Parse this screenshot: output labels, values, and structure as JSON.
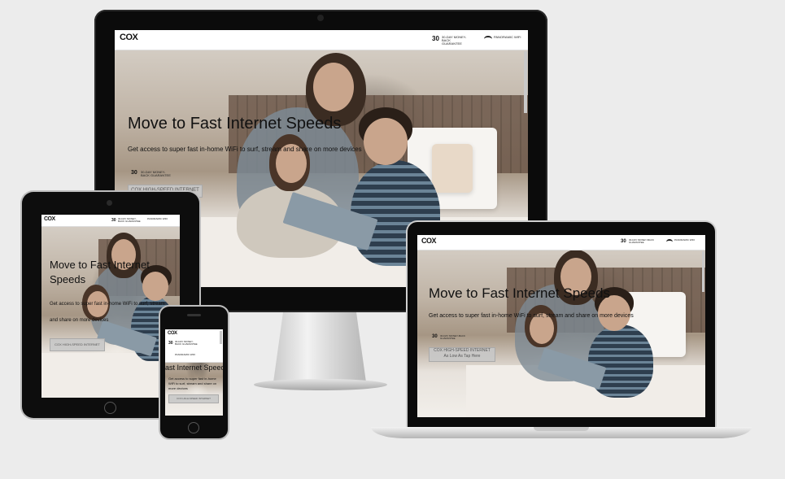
{
  "site": {
    "logo": "COX",
    "badge_number": "30",
    "badge_text": "30-DAY MONEY-BACK GUARANTEE",
    "wifi_text": "PANORAMIC WIFI",
    "hero_title": "Move to Fast Internet Speeds",
    "hero_title_line1": "Move to Fast Internet",
    "hero_title_line2": "Speeds",
    "hero_subtitle": "Get access to super fast in-home WiFi to surf, stream and share on more devices",
    "cta_label": "COX HIGH-SPEED INTERNET",
    "cta_sub": "As Low As Tap Here"
  },
  "devices": [
    "desktop-monitor",
    "tablet",
    "phone",
    "laptop"
  ],
  "colors": {
    "background": "#ececec",
    "bezel": "#111111",
    "header_bg": "#ffffff",
    "text": "#111111",
    "headboard": "#6d584a"
  },
  "icons": [
    "wifi-icon",
    "monitor-stand",
    "home-button"
  ]
}
